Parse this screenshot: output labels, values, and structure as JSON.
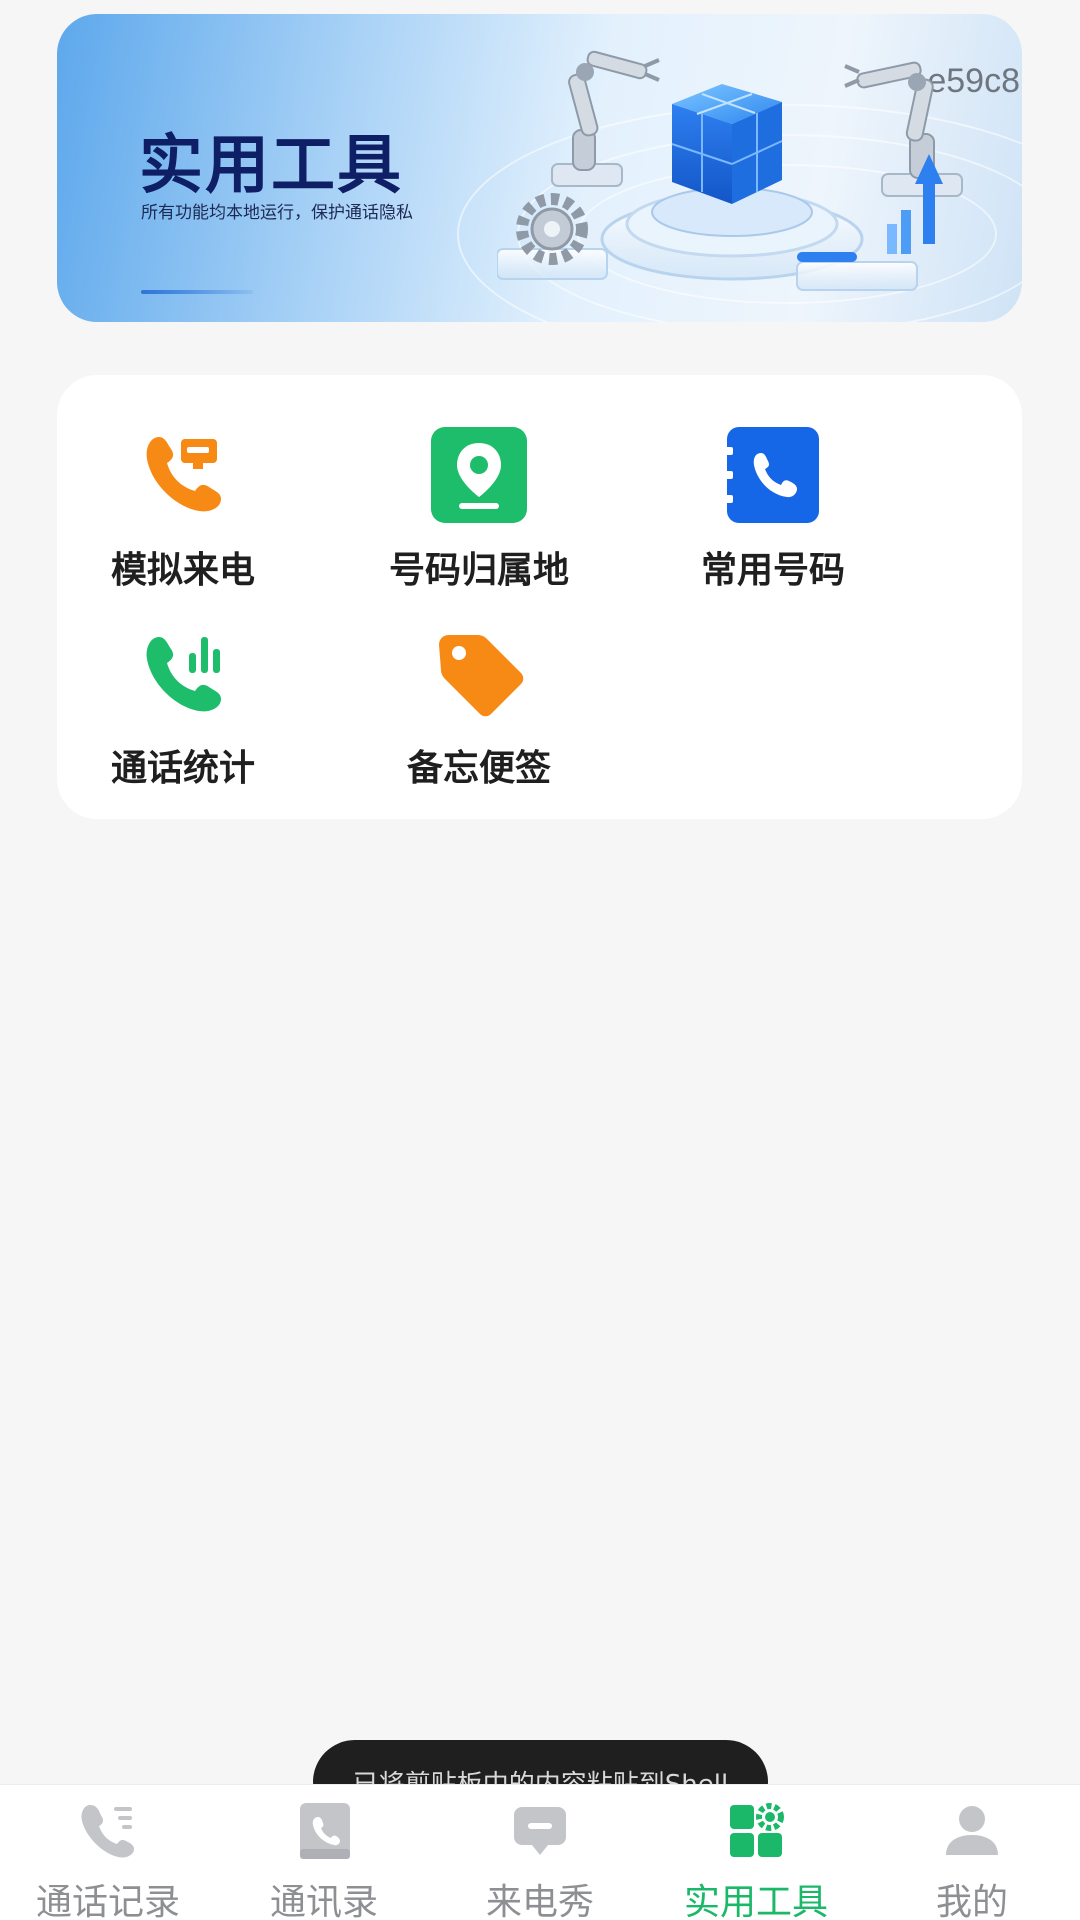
{
  "banner": {
    "title": "实用工具",
    "subtitle": "所有功能均本地运行，保护通话隐私",
    "code": "e59c8"
  },
  "tools": [
    {
      "label": "模拟来电",
      "icon": "phone-message-icon",
      "color": "#f78a14"
    },
    {
      "label": "号码归属地",
      "icon": "location-pin-icon",
      "color": "#1dbd6b"
    },
    {
      "label": "常用号码",
      "icon": "phone-book-icon",
      "color": "#1666e8"
    },
    {
      "label": "通话统计",
      "icon": "phone-stats-icon",
      "color": "#1dbd6b"
    },
    {
      "label": "备忘便签",
      "icon": "tag-icon",
      "color": "#f78a14"
    }
  ],
  "toast": {
    "text": "已将剪贴板中的内容粘贴到Shell"
  },
  "nav": {
    "items": [
      {
        "label": "通话记录",
        "icon": "call-log-icon"
      },
      {
        "label": "通讯录",
        "icon": "contacts-icon"
      },
      {
        "label": "来电秀",
        "icon": "call-show-icon"
      },
      {
        "label": "实用工具",
        "icon": "tools-icon"
      },
      {
        "label": "我的",
        "icon": "profile-icon"
      }
    ],
    "active": "实用工具",
    "active_color": "#1cb86a",
    "inactive_color": "#8d8f93"
  }
}
